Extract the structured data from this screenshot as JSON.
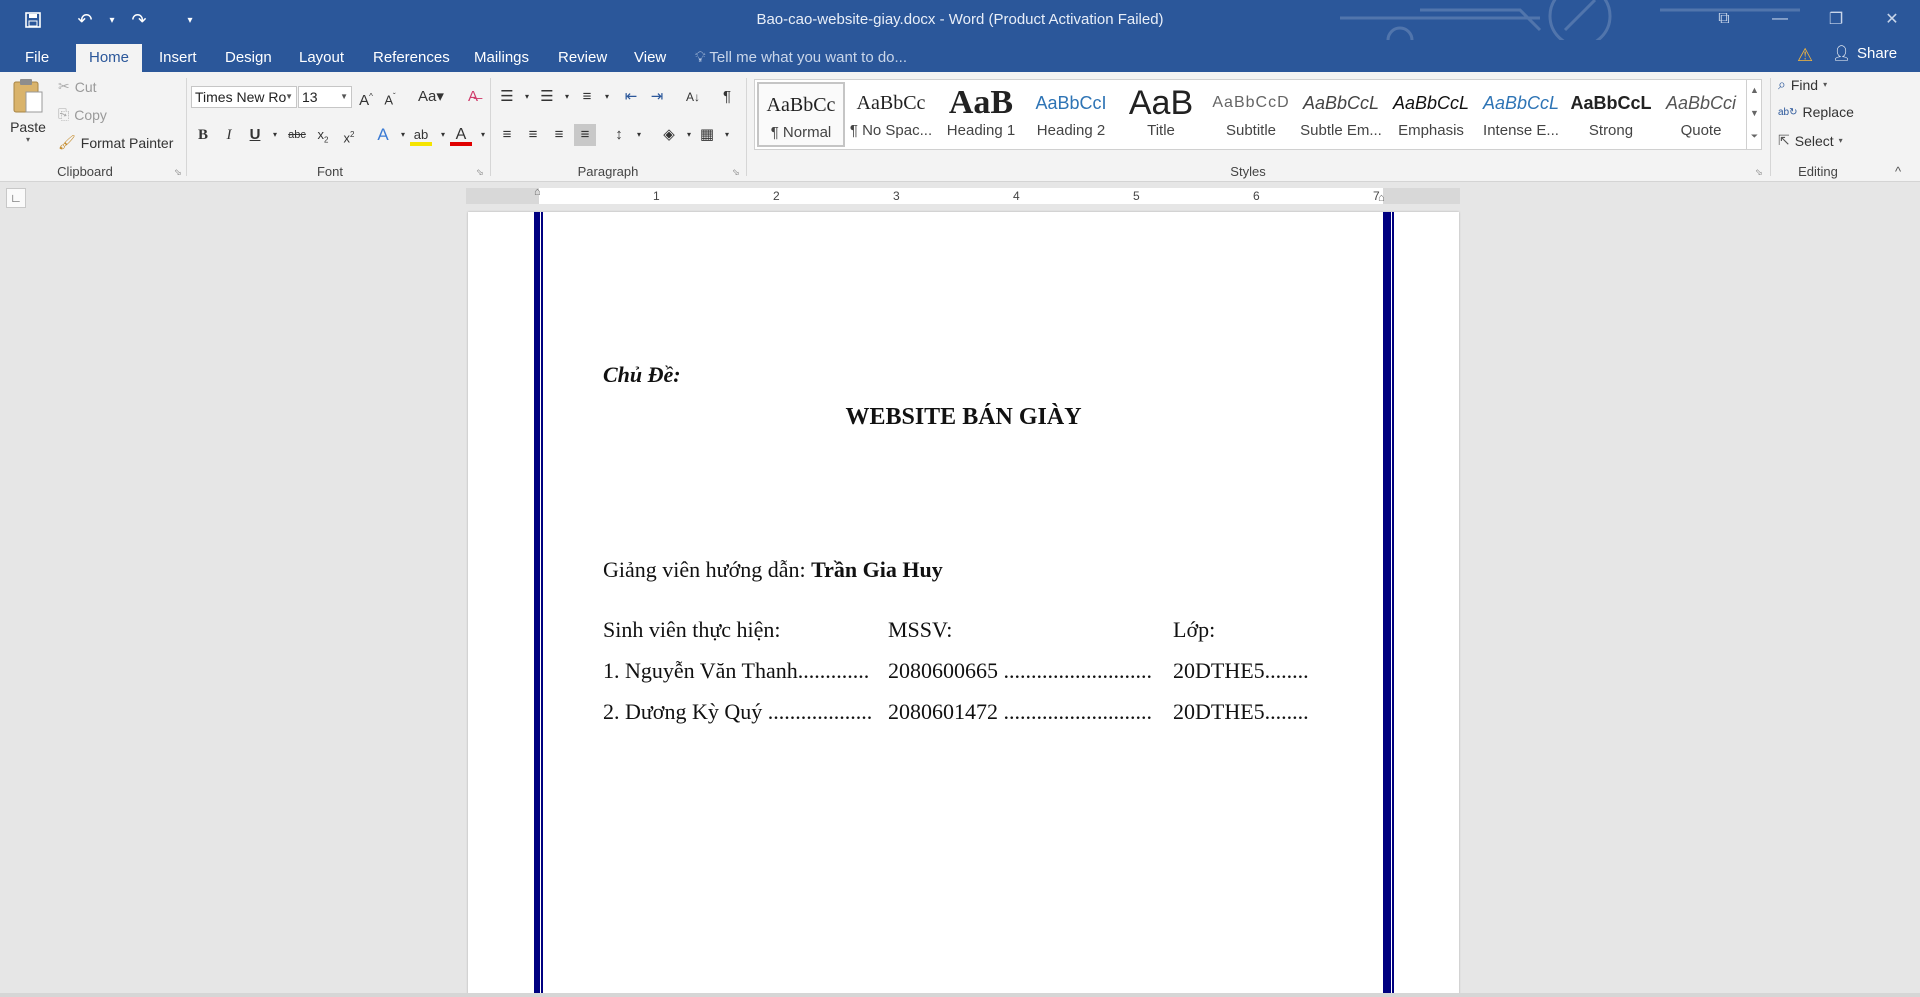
{
  "titlebar": {
    "doc_title": "Bao-cao-website-giay.docx - Word (Product Activation Failed)"
  },
  "tabs": [
    {
      "label": "File"
    },
    {
      "label": "Home"
    },
    {
      "label": "Insert"
    },
    {
      "label": "Design"
    },
    {
      "label": "Layout"
    },
    {
      "label": "References"
    },
    {
      "label": "Mailings"
    },
    {
      "label": "Review"
    },
    {
      "label": "View"
    }
  ],
  "tell_me": "Tell me what you want to do...",
  "share": "Share",
  "clipboard": {
    "paste": "Paste",
    "cut": "Cut",
    "copy": "Copy",
    "format_painter": "Format Painter",
    "label": "Clipboard"
  },
  "font": {
    "name": "Times New Ro",
    "size": "13",
    "label": "Font"
  },
  "paragraph": {
    "label": "Paragraph"
  },
  "styles": {
    "label": "Styles",
    "items": [
      {
        "preview": "AaBbCc",
        "name": "¶ Normal"
      },
      {
        "preview": "AaBbCc",
        "name": "¶ No Spac..."
      },
      {
        "preview": "AaB",
        "name": "Heading 1"
      },
      {
        "preview": "AaBbCcI",
        "name": "Heading 2"
      },
      {
        "preview": "AaB",
        "name": "Title"
      },
      {
        "preview": "AaBbCcD",
        "name": "Subtitle"
      },
      {
        "preview": "AaBbCcL",
        "name": "Subtle Em..."
      },
      {
        "preview": "AaBbCcL",
        "name": "Emphasis"
      },
      {
        "preview": "AaBbCcL",
        "name": "Intense E..."
      },
      {
        "preview": "AaBbCcL",
        "name": "Strong"
      },
      {
        "preview": "AaBbCci",
        "name": "Quote"
      }
    ]
  },
  "editing": {
    "find": "Find",
    "replace": "Replace",
    "select": "Select",
    "label": "Editing"
  },
  "ruler": {
    "numbers": [
      "1",
      "2",
      "3",
      "4",
      "5",
      "6",
      "7"
    ]
  },
  "document": {
    "topic_label": "Chủ Đề:",
    "title": "WEBSITE BÁN GIÀY",
    "advisor_label": "Giảng viên hướng dẫn:",
    "advisor_name": "Trần Gia Huy",
    "students_label": "Sinh viên thực hiện:",
    "mssv_label": "MSSV:",
    "class_label": "Lớp:",
    "students": [
      {
        "name": "1. Nguyễn Văn Thanh.............",
        "id": "2080600665 ...........................",
        "class": "20DTHE5........"
      },
      {
        "name": "2. Dương Kỳ Quý ...................",
        "id": "2080601472 ...........................",
        "class": "20DTHE5........"
      }
    ]
  }
}
